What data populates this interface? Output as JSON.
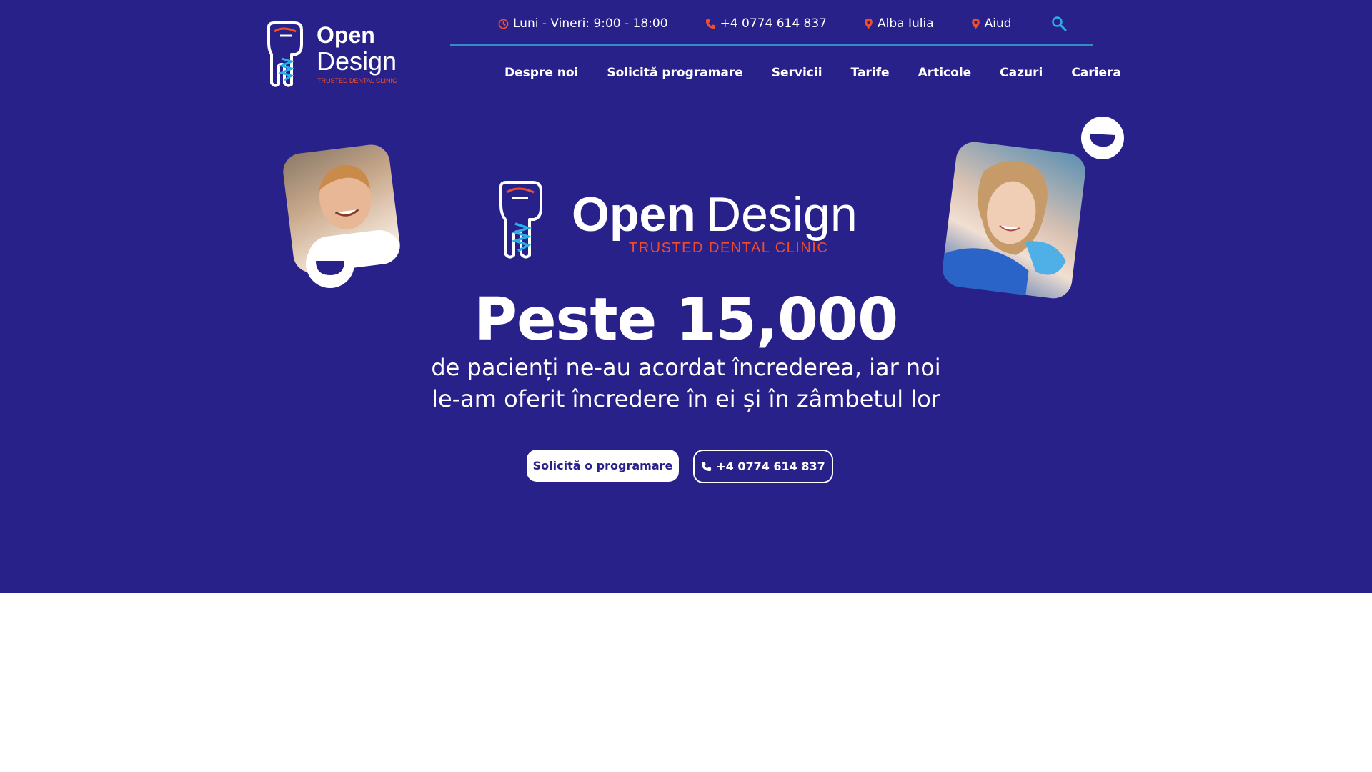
{
  "brand": {
    "word1": "Open",
    "word2": "Design",
    "tagline": "TRUSTED DENTAL CLINIC"
  },
  "topbar": {
    "hours": "Luni - Vineri: 9:00 - 18:00",
    "phone": "+4 0774 614 837",
    "location1": "Alba Iulia",
    "location2": "Aiud"
  },
  "nav": {
    "items": [
      "Despre noi",
      "Solicită programare",
      "Servicii",
      "Tarife",
      "Articole",
      "Cazuri",
      "Cariera"
    ]
  },
  "hero": {
    "headline": "Peste 15,000",
    "line1": "de pacienți ne-au acordat încrederea, iar noi",
    "line2": "le-am oferit încredere în ei și în zâmbetul lor",
    "cta_primary": "Solicită o programare",
    "cta_phone": "+4 0774 614 837"
  },
  "colors": {
    "background": "#29218a",
    "accent_orange": "#f04e2b",
    "accent_cyan": "#2aaee8",
    "white": "#ffffff"
  },
  "icons": {
    "hours": "clock-icon",
    "phone": "phone-icon",
    "location": "map-pin-icon",
    "search": "search-icon"
  }
}
